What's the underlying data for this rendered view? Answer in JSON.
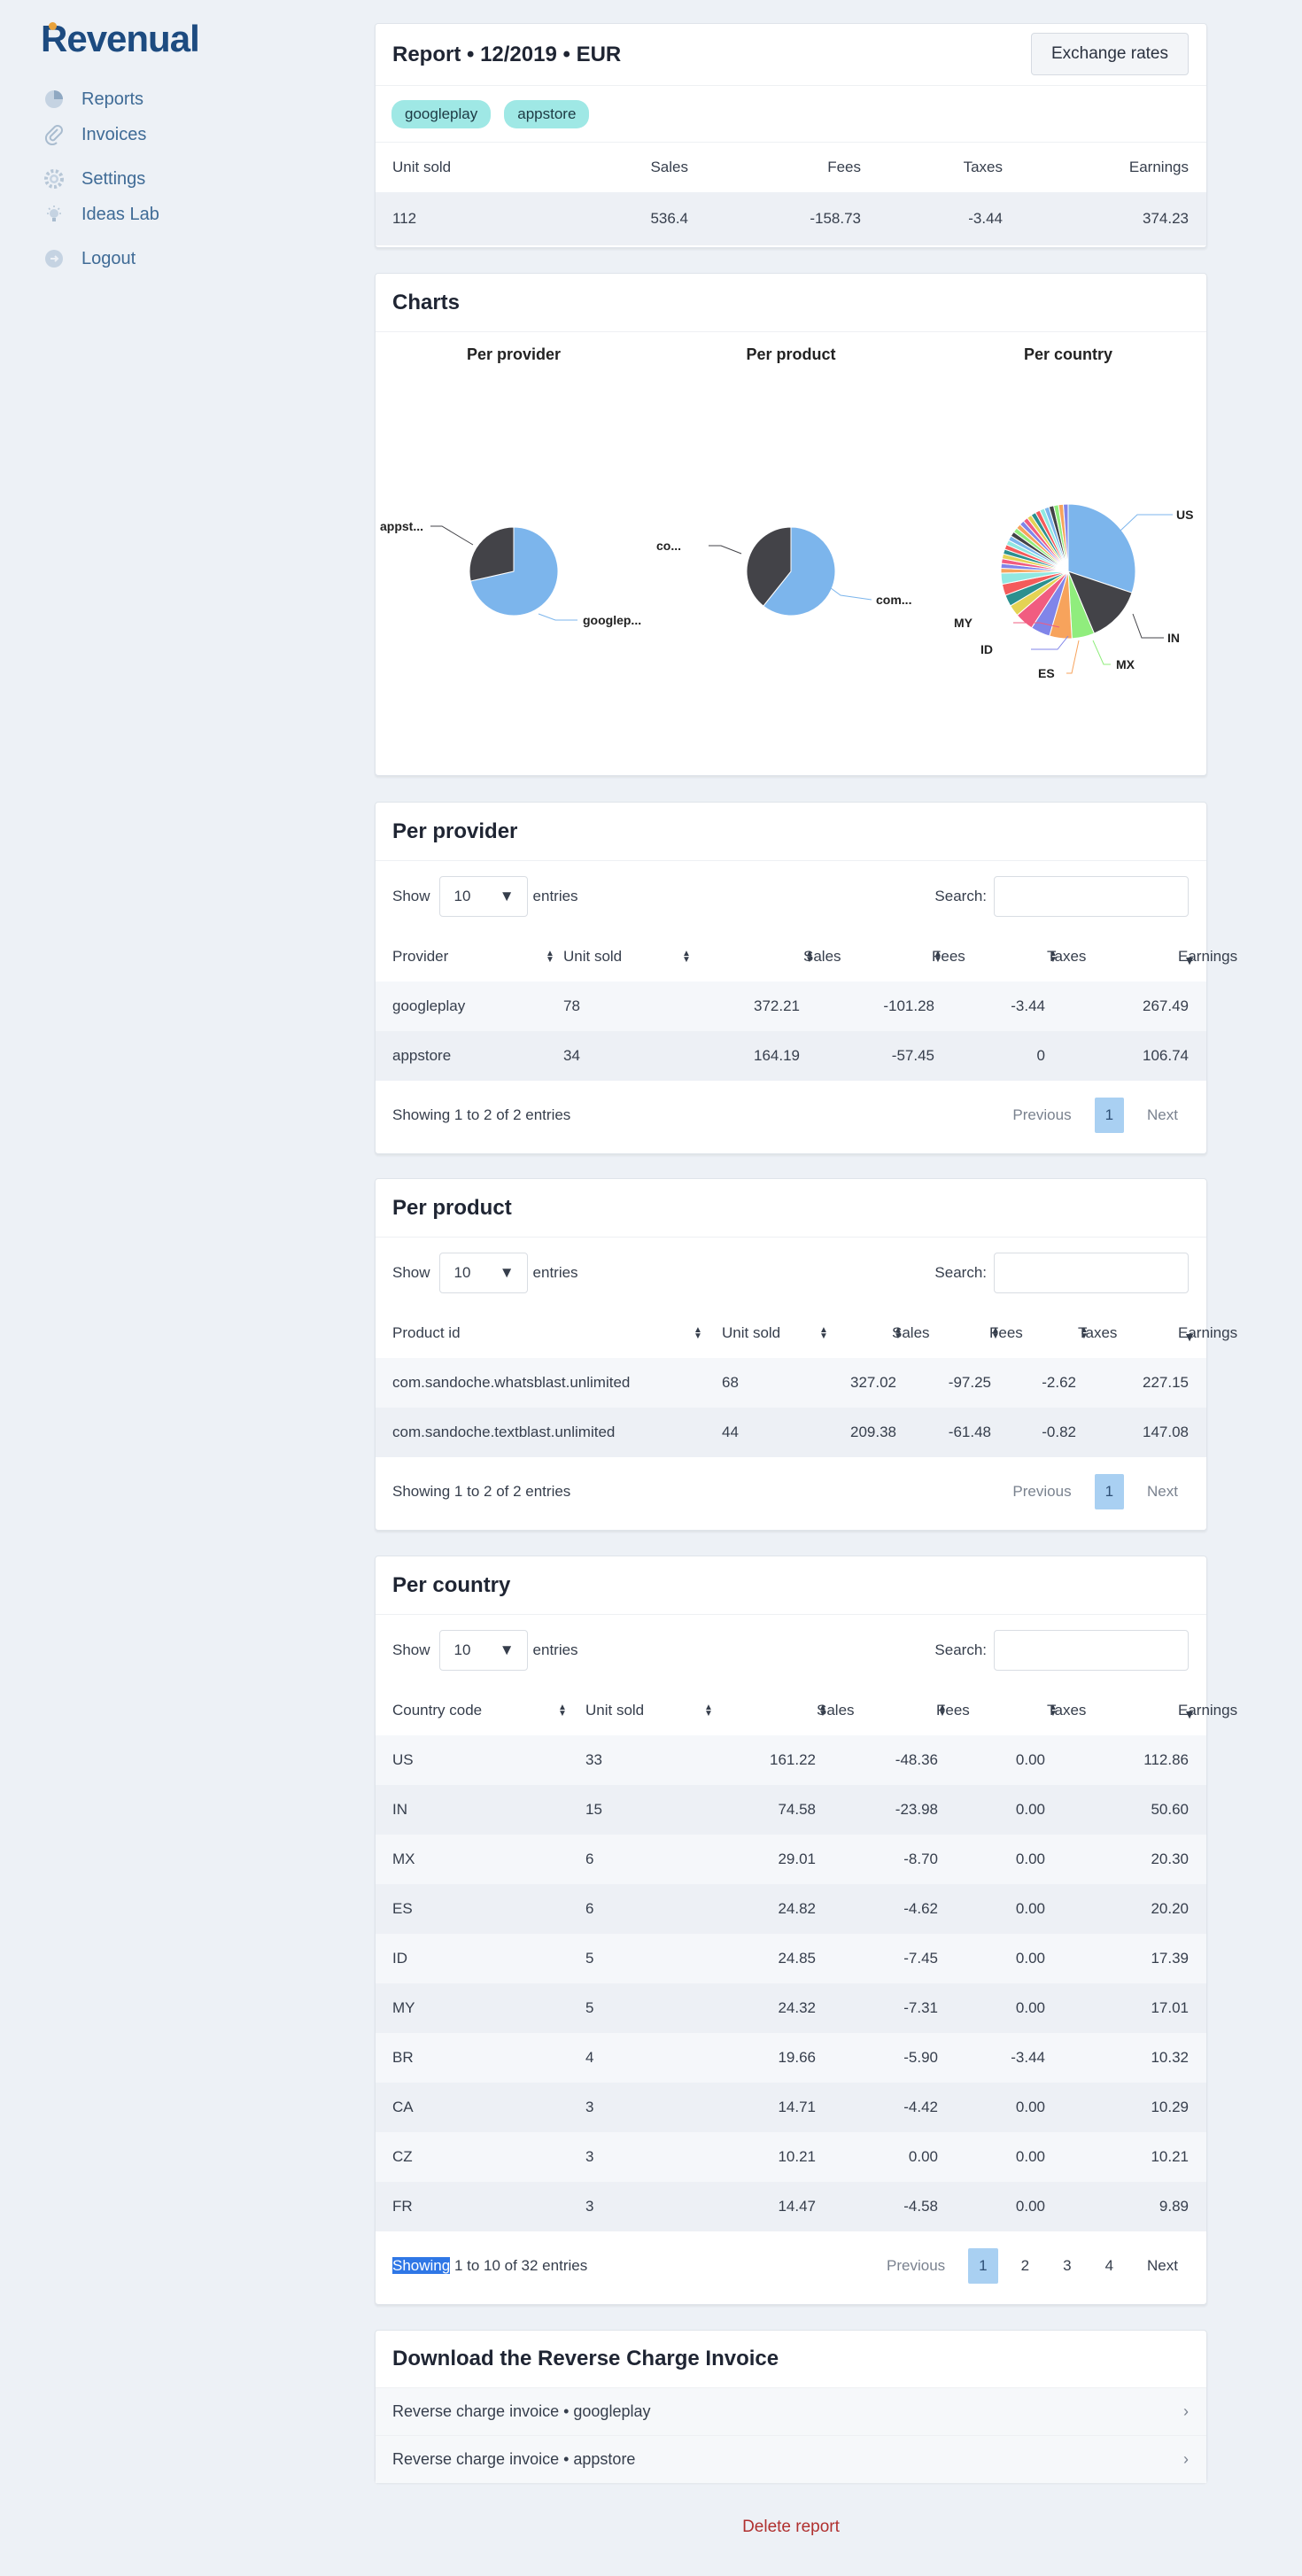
{
  "app": {
    "logo": "Revenual"
  },
  "sidebar": {
    "items": [
      {
        "label": "Reports",
        "icon": "pie-chart-icon"
      },
      {
        "label": "Invoices",
        "icon": "paperclip-icon"
      },
      {
        "label": "Settings",
        "icon": "gear-icon"
      },
      {
        "label": "Ideas Lab",
        "icon": "lightbulb-icon"
      },
      {
        "label": "Logout",
        "icon": "logout-icon"
      }
    ]
  },
  "report": {
    "title": "Report • 12/2019 • EUR",
    "exchange_button": "Exchange rates",
    "tags": [
      "googleplay",
      "appstore"
    ],
    "headers": [
      "Unit sold",
      "Sales",
      "Fees",
      "Taxes",
      "Earnings"
    ],
    "values": [
      "112",
      "536.4",
      "-158.73",
      "-3.44",
      "374.23"
    ]
  },
  "charts": {
    "title": "Charts",
    "provider": {
      "title": "Per provider",
      "labels": [
        "appst...",
        "googlep..."
      ]
    },
    "product": {
      "title": "Per product",
      "labels": [
        "co...",
        "com..."
      ]
    },
    "country": {
      "title": "Per country",
      "labels": [
        "US",
        "IN",
        "MX",
        "ES",
        "ID",
        "MY"
      ]
    }
  },
  "chart_data": [
    {
      "type": "pie",
      "title": "Per provider",
      "categories": [
        "googleplay",
        "appstore"
      ],
      "values": [
        267.49,
        106.74
      ],
      "colors": [
        "#7cb5ec",
        "#434348"
      ]
    },
    {
      "type": "pie",
      "title": "Per product",
      "categories": [
        "com.sandoche.whatsblast.unlimited",
        "com.sandoche.textblast.unlimited"
      ],
      "values": [
        227.15,
        147.08
      ],
      "colors": [
        "#7cb5ec",
        "#434348"
      ]
    },
    {
      "type": "pie",
      "title": "Per country",
      "categories": [
        "US",
        "IN",
        "MX",
        "ES",
        "ID",
        "MY",
        "BR",
        "CA",
        "CZ",
        "FR"
      ],
      "values": [
        112.86,
        50.6,
        20.3,
        20.2,
        17.39,
        17.01,
        10.32,
        10.29,
        10.21,
        9.89
      ]
    }
  ],
  "per_provider": {
    "title": "Per provider",
    "show": "Show",
    "show_value": "10",
    "entries": "entries",
    "search": "Search:",
    "headers": [
      "Provider",
      "Unit sold",
      "Sales",
      "Fees",
      "Taxes",
      "Earnings"
    ],
    "rows": [
      [
        "googleplay",
        "78",
        "372.21",
        "-101.28",
        "-3.44",
        "267.49"
      ],
      [
        "appstore",
        "34",
        "164.19",
        "-57.45",
        "0",
        "106.74"
      ]
    ],
    "info": "Showing 1 to 2 of 2 entries",
    "prev": "Previous",
    "page": "1",
    "next": "Next"
  },
  "per_product": {
    "title": "Per product",
    "show": "Show",
    "show_value": "10",
    "entries": "entries",
    "search": "Search:",
    "headers": [
      "Product id",
      "Unit sold",
      "Sales",
      "Fees",
      "Taxes",
      "Earnings"
    ],
    "rows": [
      [
        "com.sandoche.whatsblast.unlimited",
        "68",
        "327.02",
        "-97.25",
        "-2.62",
        "227.15"
      ],
      [
        "com.sandoche.textblast.unlimited",
        "44",
        "209.38",
        "-61.48",
        "-0.82",
        "147.08"
      ]
    ],
    "info": "Showing 1 to 2 of 2 entries",
    "prev": "Previous",
    "page": "1",
    "next": "Next"
  },
  "per_country": {
    "title": "Per country",
    "show": "Show",
    "show_value": "10",
    "entries": "entries",
    "search": "Search:",
    "headers": [
      "Country code",
      "Unit sold",
      "Sales",
      "Fees",
      "Taxes",
      "Earnings"
    ],
    "rows": [
      [
        "US",
        "33",
        "161.22",
        "-48.36",
        "0.00",
        "112.86"
      ],
      [
        "IN",
        "15",
        "74.58",
        "-23.98",
        "0.00",
        "50.60"
      ],
      [
        "MX",
        "6",
        "29.01",
        "-8.70",
        "0.00",
        "20.30"
      ],
      [
        "ES",
        "6",
        "24.82",
        "-4.62",
        "0.00",
        "20.20"
      ],
      [
        "ID",
        "5",
        "24.85",
        "-7.45",
        "0.00",
        "17.39"
      ],
      [
        "MY",
        "5",
        "24.32",
        "-7.31",
        "0.00",
        "17.01"
      ],
      [
        "BR",
        "4",
        "19.66",
        "-5.90",
        "-3.44",
        "10.32"
      ],
      [
        "CA",
        "3",
        "14.71",
        "-4.42",
        "0.00",
        "10.29"
      ],
      [
        "CZ",
        "3",
        "10.21",
        "0.00",
        "0.00",
        "10.21"
      ],
      [
        "FR",
        "3",
        "14.47",
        "-4.58",
        "0.00",
        "9.89"
      ]
    ],
    "info_hl": "Showing",
    "info_rest": " 1 to 10 of 32 entries",
    "prev": "Previous",
    "pages": [
      "1",
      "2",
      "3",
      "4"
    ],
    "next": "Next"
  },
  "download": {
    "title": "Download the Reverse Charge Invoice",
    "items": [
      "Reverse charge invoice • googleplay",
      "Reverse charge invoice • appstore"
    ]
  },
  "delete_label": "Delete report"
}
